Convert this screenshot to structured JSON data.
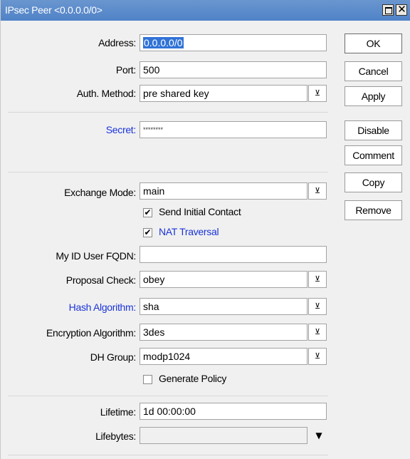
{
  "window": {
    "title": "IPsec Peer <0.0.0.0/0>"
  },
  "fields": {
    "address": {
      "label": "Address:",
      "value": "0.0.0.0/0"
    },
    "port": {
      "label": "Port:",
      "value": "500"
    },
    "auth_method": {
      "label": "Auth. Method:",
      "value": "pre shared key"
    },
    "secret": {
      "label": "Secret:",
      "value": "********"
    },
    "exchange_mode": {
      "label": "Exchange Mode:",
      "value": "main"
    },
    "send_initial_contact": {
      "label": "Send Initial Contact",
      "checked": true
    },
    "nat_traversal": {
      "label": "NAT Traversal",
      "checked": true
    },
    "my_id_user_fqdn": {
      "label": "My ID User FQDN:",
      "value": ""
    },
    "proposal_check": {
      "label": "Proposal Check:",
      "value": "obey"
    },
    "hash_algorithm": {
      "label": "Hash Algorithm:",
      "value": "sha"
    },
    "encryption_algorithm": {
      "label": "Encryption Algorithm:",
      "value": "3des"
    },
    "dh_group": {
      "label": "DH Group:",
      "value": "modp1024"
    },
    "generate_policy": {
      "label": "Generate Policy",
      "checked": false
    },
    "lifetime": {
      "label": "Lifetime:",
      "value": "1d 00:00:00"
    },
    "lifebytes": {
      "label": "Lifebytes:",
      "value": ""
    }
  },
  "buttons": {
    "ok": "OK",
    "cancel": "Cancel",
    "apply": "Apply",
    "disable": "Disable",
    "comment": "Comment",
    "copy": "Copy",
    "remove": "Remove"
  },
  "glyphs": {
    "dropdown": "⊻",
    "dropdown_arrow": "▼",
    "check": "✔",
    "close": "✕"
  }
}
